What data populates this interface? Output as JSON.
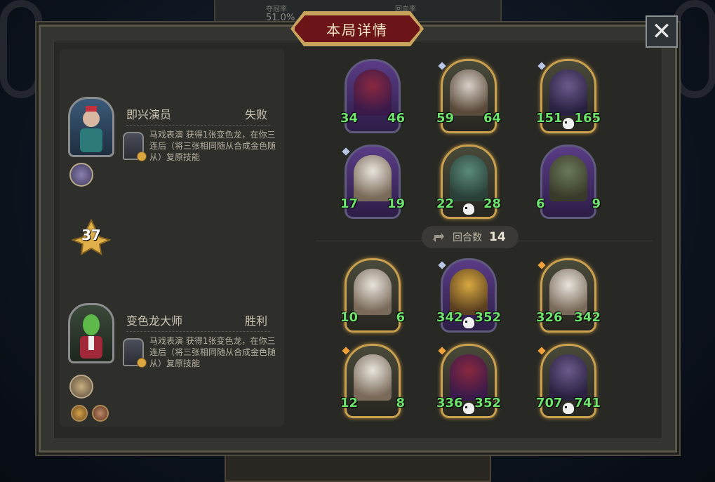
{
  "background": {
    "top_stat_1_label": "夺冠率",
    "top_stat_1_value": "51.0%",
    "top_stat_2_label": "回血率"
  },
  "dialog": {
    "title": "本局详情",
    "close_icon": "close-icon",
    "round_label": "回合数",
    "round_value": "14",
    "level": "37"
  },
  "players": [
    {
      "name": "即兴演员",
      "result": "失败",
      "skill_text": "马戏表演 获得1张变色龙，在你三连后（将三张相同随从合成金色随从）复原技能",
      "badge_icon": "ghost-badge-icon",
      "colors": {
        "portrait_bg": "#3b5a78"
      }
    },
    {
      "name": "变色龙大师",
      "result": "胜利",
      "skill_text": "马戏表演 获得1张变色龙，在你三连后（将三张相同随从合成金色随从）复原技能",
      "badge_icon": "circus-badge-icon",
      "colors": {
        "portrait_bg": "#3a4a3a"
      }
    }
  ],
  "opponent_board": [
    {
      "atk": "34",
      "hp": "46",
      "frame": "purple",
      "art": "clown-icon",
      "skull": false,
      "gem": false
    },
    {
      "atk": "59",
      "hp": "64",
      "frame": "gold",
      "art": "rat-pirate-icon",
      "skull": false,
      "gem": true
    },
    {
      "atk": "151",
      "hp": "165",
      "frame": "gold",
      "art": "octopus-pirate-icon",
      "skull": true,
      "gem": true
    },
    {
      "atk": "17",
      "hp": "19",
      "frame": "purple",
      "art": "pelican-icon",
      "skull": false,
      "gem": true
    },
    {
      "atk": "22",
      "hp": "28",
      "frame": "gold",
      "art": "crocodile-icon",
      "skull": true,
      "gem": false
    },
    {
      "atk": "6",
      "hp": "9",
      "frame": "purple",
      "art": "turtle-icon",
      "skull": false,
      "gem": false
    }
  ],
  "player_board": [
    {
      "atk": "10",
      "hp": "6",
      "frame": "gold",
      "art": "pelican-icon",
      "skull": false,
      "gem": false
    },
    {
      "atk": "342",
      "hp": "352",
      "frame": "purple",
      "art": "scarecrow-icon",
      "skull": true,
      "gem": true
    },
    {
      "atk": "326",
      "hp": "342",
      "frame": "gold",
      "art": "pelican-icon",
      "skull": false,
      "gem": true
    },
    {
      "atk": "12",
      "hp": "8",
      "frame": "gold",
      "art": "pelican-icon",
      "skull": false,
      "gem": true
    },
    {
      "atk": "336",
      "hp": "352",
      "frame": "gold",
      "art": "clown-icon",
      "skull": true,
      "gem": true
    },
    {
      "atk": "707",
      "hp": "741",
      "frame": "gold",
      "art": "octopus-pirate-icon",
      "skull": true,
      "gem": true
    }
  ],
  "colors": {
    "stat_green": "#6ee36e",
    "banner_red": "#6b1518",
    "gold_border": "#c9a45c"
  }
}
